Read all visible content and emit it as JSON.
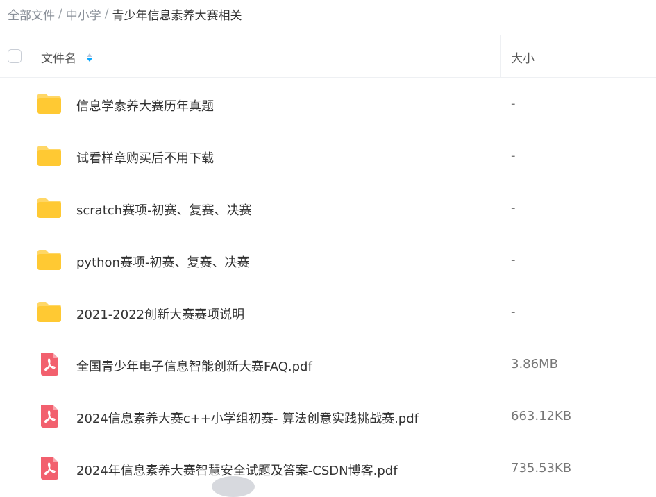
{
  "breadcrumb": {
    "items": [
      "全部文件",
      "中小学"
    ],
    "separator": "/",
    "current": "青少年信息素养大赛相关"
  },
  "table": {
    "columns": {
      "name": "文件名",
      "size": "大小"
    }
  },
  "colors": {
    "folder": "#FFC933",
    "pdf": "#F2606E",
    "sort_active": "#06A7FF"
  },
  "files": [
    {
      "type": "folder",
      "icon": "folder-icon",
      "name": "信息学素养大赛历年真题",
      "size": "-"
    },
    {
      "type": "folder",
      "icon": "folder-icon",
      "name": "试看样章购买后不用下载",
      "size": "-"
    },
    {
      "type": "folder",
      "icon": "folder-icon",
      "name": "scratch赛项-初赛、复赛、决赛",
      "size": "-"
    },
    {
      "type": "folder",
      "icon": "folder-icon",
      "name": "python赛项-初赛、复赛、决赛",
      "size": "-"
    },
    {
      "type": "folder",
      "icon": "folder-icon",
      "name": "2021-2022创新大赛赛项说明",
      "size": "-"
    },
    {
      "type": "pdf",
      "icon": "pdf-icon",
      "name": "全国青少年电子信息智能创新大赛FAQ.pdf",
      "size": "3.86MB"
    },
    {
      "type": "pdf",
      "icon": "pdf-icon",
      "name": "2024信息素养大赛c++小学组初赛- 算法创意实践挑战赛.pdf",
      "size": "663.12KB"
    },
    {
      "type": "pdf",
      "icon": "pdf-icon",
      "name": "2024年信息素养大赛智慧安全试题及答案-CSDN博客.pdf",
      "size": "735.53KB"
    }
  ]
}
